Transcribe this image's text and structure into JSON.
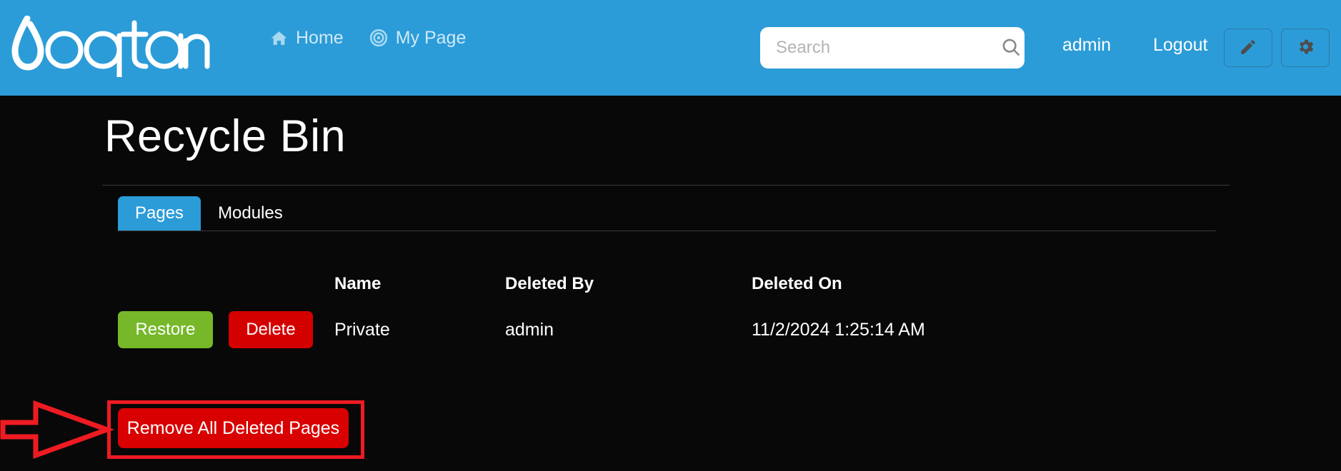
{
  "header": {
    "logo_text": "oqtane",
    "logo_icon": "water-droplet-icon",
    "nav": [
      {
        "label": "Home",
        "icon": "home-icon"
      },
      {
        "label": "My Page",
        "icon": "target-bullseye-icon"
      }
    ],
    "search": {
      "placeholder": "Search",
      "value": "",
      "icon": "search-icon"
    },
    "user": "admin",
    "logout": "Logout",
    "edit_icon": "pencil-edit-icon",
    "settings_icon": "gear-settings-icon",
    "colors": {
      "bar": "#2b9cd8",
      "nav_text": "#cfe9f7",
      "user_text": "#ffffff"
    }
  },
  "page": {
    "title": "Recycle Bin",
    "background": "#080808"
  },
  "tabs": [
    {
      "label": "Pages",
      "active": true
    },
    {
      "label": "Modules",
      "active": false
    }
  ],
  "table": {
    "columns": [
      "Name",
      "Deleted By",
      "Deleted On"
    ],
    "rows": [
      {
        "restore_label": "Restore",
        "delete_label": "Delete",
        "name": "Private",
        "deleted_by": "admin",
        "deleted_on": "11/2/2024 1:25:14 AM"
      }
    ]
  },
  "footer": {
    "remove_all_label": "Remove All Deleted Pages"
  },
  "annotation": {
    "color": "#ee1b22",
    "arrow": "right-arrow-annotation",
    "highlight": "rectangle-highlight-annotation"
  },
  "colors": {
    "accent_blue": "#2b9cd8",
    "danger_red": "#d80000",
    "success_green": "#76b82a",
    "annotation_red": "#ee1b22"
  }
}
